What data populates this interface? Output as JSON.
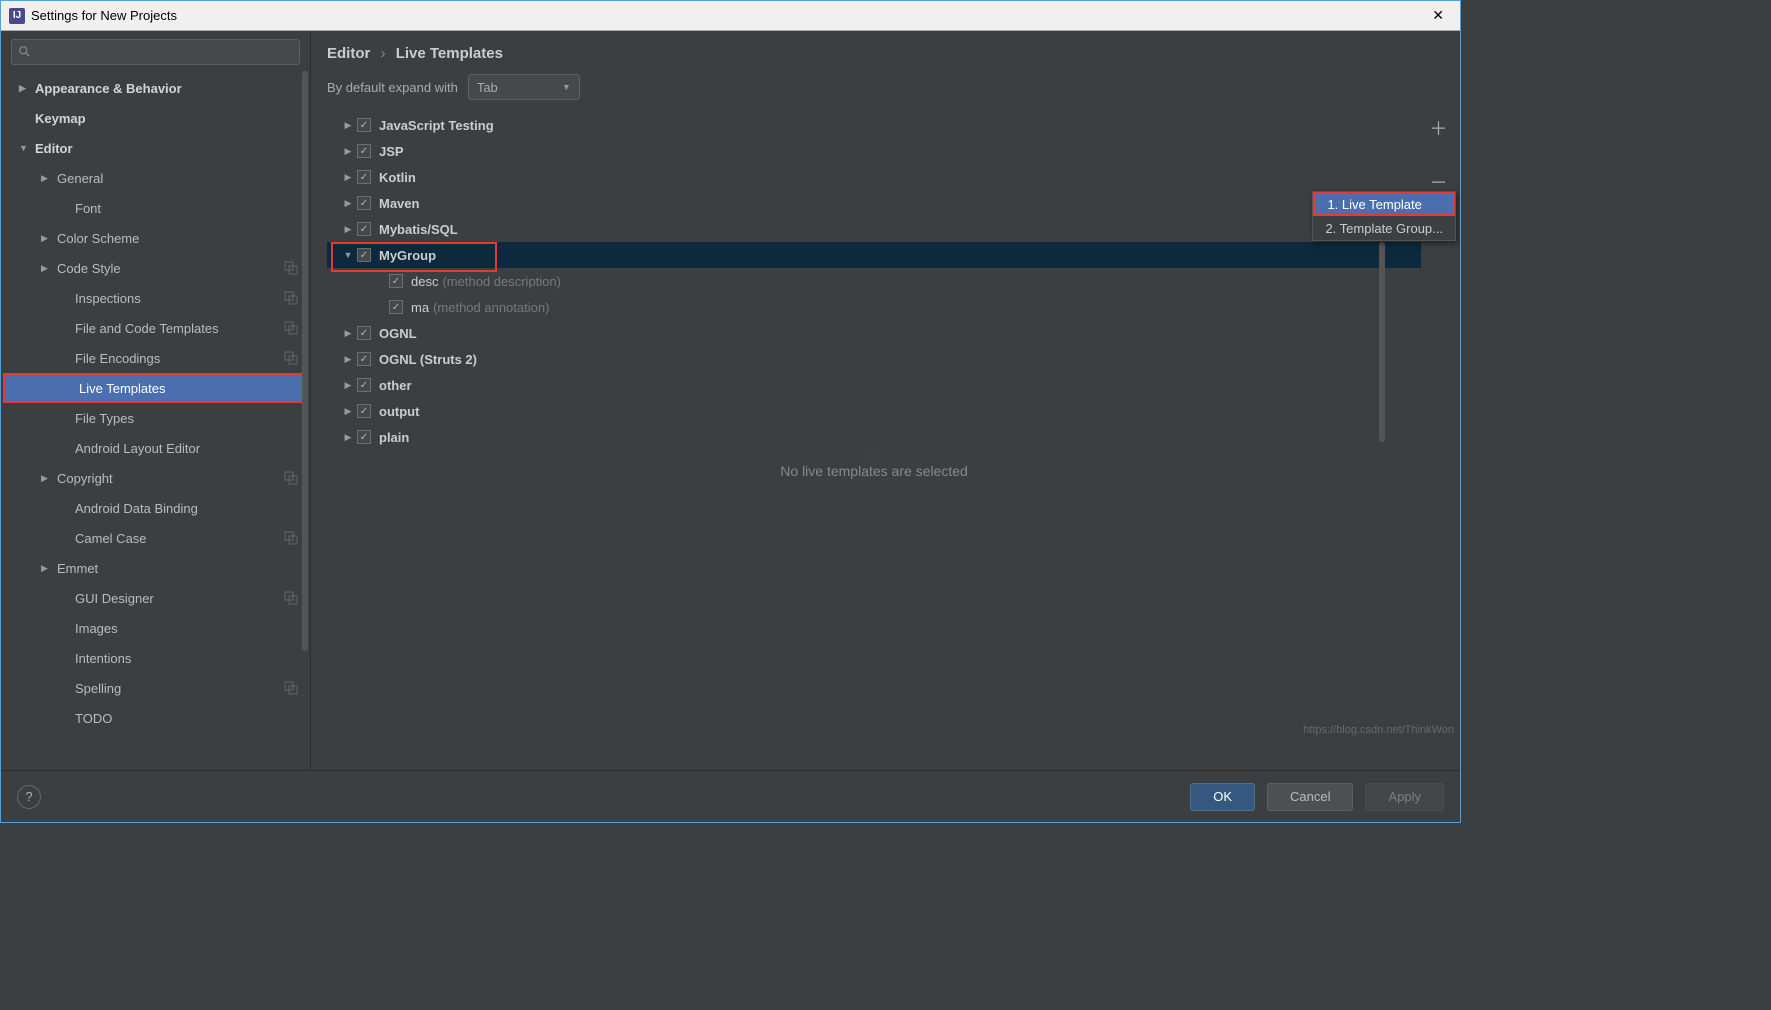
{
  "window": {
    "title": "Settings for New Projects"
  },
  "sidebar": {
    "items": [
      {
        "label": "Appearance & Behavior",
        "arrow": "right",
        "bold": true,
        "level": 0
      },
      {
        "label": "Keymap",
        "arrow": "",
        "bold": true,
        "level": 0
      },
      {
        "label": "Editor",
        "arrow": "down",
        "bold": true,
        "level": 0
      },
      {
        "label": "General",
        "arrow": "right",
        "level": 1
      },
      {
        "label": "Font",
        "arrow": "",
        "level": 2
      },
      {
        "label": "Color Scheme",
        "arrow": "right",
        "level": 1
      },
      {
        "label": "Code Style",
        "arrow": "right",
        "level": 1,
        "modified": true
      },
      {
        "label": "Inspections",
        "arrow": "",
        "level": 2,
        "modified": true
      },
      {
        "label": "File and Code Templates",
        "arrow": "",
        "level": 2,
        "modified": true
      },
      {
        "label": "File Encodings",
        "arrow": "",
        "level": 2,
        "modified": true
      },
      {
        "label": "Live Templates",
        "arrow": "",
        "level": 2,
        "selected": true,
        "highlighted": true
      },
      {
        "label": "File Types",
        "arrow": "",
        "level": 2
      },
      {
        "label": "Android Layout Editor",
        "arrow": "",
        "level": 2
      },
      {
        "label": "Copyright",
        "arrow": "right",
        "level": 1,
        "modified": true
      },
      {
        "label": "Android Data Binding",
        "arrow": "",
        "level": 2
      },
      {
        "label": "Camel Case",
        "arrow": "",
        "level": 2,
        "modified": true
      },
      {
        "label": "Emmet",
        "arrow": "right",
        "level": 1
      },
      {
        "label": "GUI Designer",
        "arrow": "",
        "level": 2,
        "modified": true
      },
      {
        "label": "Images",
        "arrow": "",
        "level": 2
      },
      {
        "label": "Intentions",
        "arrow": "",
        "level": 2
      },
      {
        "label": "Spelling",
        "arrow": "",
        "level": 2,
        "modified": true
      },
      {
        "label": "TODO",
        "arrow": "",
        "level": 2
      }
    ]
  },
  "breadcrumb": {
    "item0": "Editor",
    "item1": "Live Templates"
  },
  "expand": {
    "label": "By default expand with",
    "value": "Tab"
  },
  "templates": {
    "groups": [
      {
        "name": "JavaScript Testing",
        "arrow": "right"
      },
      {
        "name": "JSP",
        "arrow": "right"
      },
      {
        "name": "Kotlin",
        "arrow": "right"
      },
      {
        "name": "Maven",
        "arrow": "right"
      },
      {
        "name": "Mybatis/SQL",
        "arrow": "right"
      },
      {
        "name": "MyGroup",
        "arrow": "down",
        "selected": true,
        "highlighted": true,
        "children": [
          {
            "abbr": "desc",
            "desc": "(method description)"
          },
          {
            "abbr": "ma",
            "desc": "(method annotation)"
          }
        ]
      },
      {
        "name": "OGNL",
        "arrow": "right"
      },
      {
        "name": "OGNL (Struts 2)",
        "arrow": "right"
      },
      {
        "name": "other",
        "arrow": "right"
      },
      {
        "name": "output",
        "arrow": "right"
      },
      {
        "name": "plain",
        "arrow": "right"
      }
    ]
  },
  "popup": {
    "items": [
      {
        "label": "1. Live Template",
        "selected": true,
        "highlighted": true
      },
      {
        "label": "2. Template Group..."
      }
    ]
  },
  "detail": {
    "empty": "No live templates are selected"
  },
  "footer": {
    "ok": "OK",
    "cancel": "Cancel",
    "apply": "Apply"
  },
  "watermark": "https://blog.csdn.net/ThinkWon"
}
